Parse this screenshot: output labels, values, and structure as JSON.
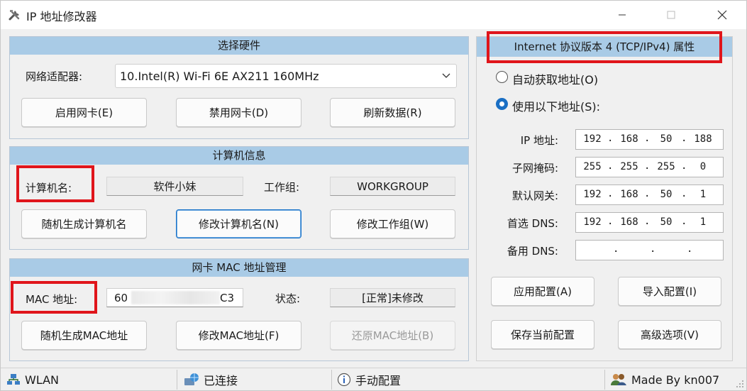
{
  "window": {
    "title": "IP 地址修改器"
  },
  "hardware": {
    "header": "选择硬件",
    "adapter_label": "网络适配器:",
    "adapter_value": "10.Intel(R) Wi-Fi 6E AX211 160MHz",
    "enable_btn": "启用网卡(E)",
    "disable_btn": "禁用网卡(D)",
    "refresh_btn": "刷新数据(R)"
  },
  "computer": {
    "header": "计算机信息",
    "name_label": "计算机名:",
    "name_value": "软件小妹",
    "workgroup_label": "工作组:",
    "workgroup_value": "WORKGROUP",
    "random_name_btn": "随机生成计算机名",
    "modify_name_btn": "修改计算机名(N)",
    "modify_wg_btn": "修改工作组(W)"
  },
  "mac": {
    "header": "网卡 MAC 地址管理",
    "mac_label": "MAC 地址:",
    "mac_prefix": "60",
    "mac_suffix": "C3",
    "state_label": "状态:",
    "state_value": "[正常]未修改",
    "random_mac_btn": "随机生成MAC地址",
    "modify_mac_btn": "修改MAC地址(F)",
    "restore_mac_btn": "还原MAC地址(B)"
  },
  "ipv4": {
    "header": "Internet 协议版本 4 (TCP/IPv4) 属性",
    "auto_label": "自动获取地址(O)",
    "manual_label": "使用以下地址(S):",
    "selected": "manual",
    "ip_label": "IP 地址:",
    "mask_label": "子网掩码:",
    "gateway_label": "默认网关:",
    "dns1_label": "首选 DNS:",
    "dns2_label": "备用 DNS:",
    "ip": [
      "192",
      "168",
      "50",
      "188"
    ],
    "mask": [
      "255",
      "255",
      "255",
      "0"
    ],
    "gateway": [
      "192",
      "168",
      "50",
      "1"
    ],
    "dns1": [
      "192",
      "168",
      "50",
      "1"
    ],
    "dns2": [
      "",
      "",
      "",
      ""
    ],
    "apply_btn": "应用配置(A)",
    "import_btn": "导入配置(I)",
    "save_btn": "保存当前配置",
    "advanced_btn": "高级选项(V)"
  },
  "status": {
    "network": "WLAN",
    "connection": "已连接",
    "mode": "手动配置",
    "author": "Made By kn007"
  },
  "colors": {
    "panel_header": "#a9cbe6",
    "highlight_box": "#e0151b",
    "accent": "#1a6fc4"
  }
}
